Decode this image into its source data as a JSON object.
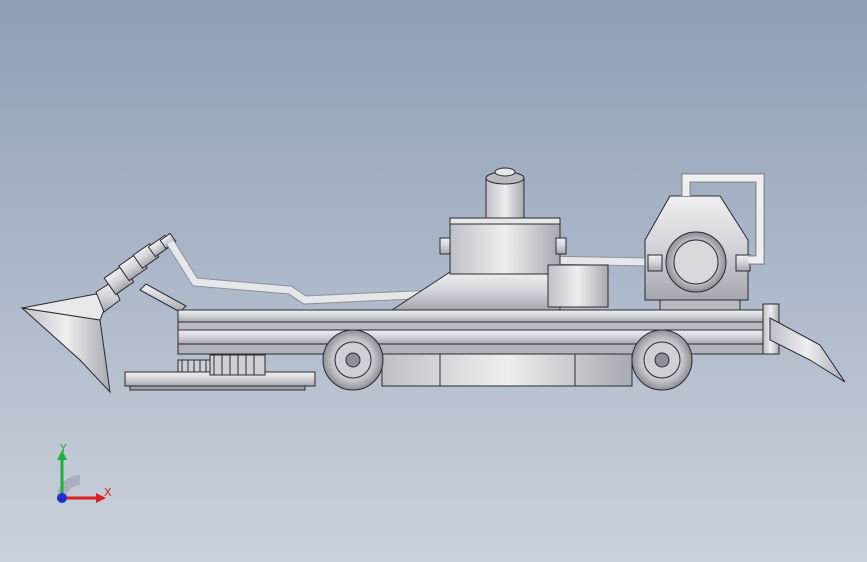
{
  "viewport": {
    "background_top": "#8f9fb8",
    "background_bottom": "#cbd1db"
  },
  "model": {
    "body_color": "#d9d9dd",
    "shade_color": "#a9abb2",
    "edge_color": "#2b2b30"
  },
  "triad": {
    "x_label": "X",
    "y_label": "Y",
    "x_color": "#e02020",
    "y_color": "#20b040",
    "z_color": "#2030d0"
  }
}
